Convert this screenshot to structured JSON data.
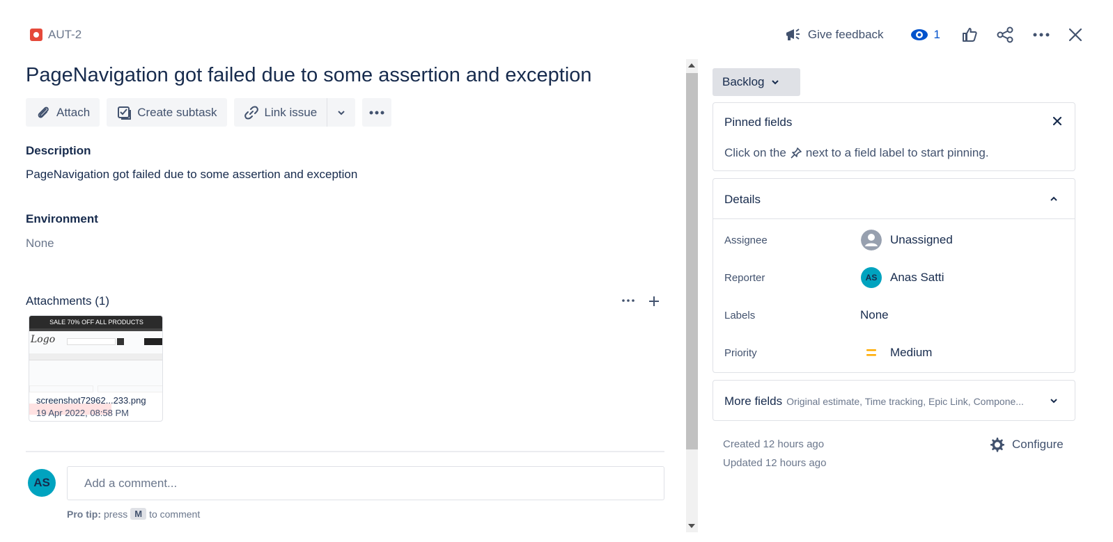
{
  "header": {
    "issue_key": "AUT-2",
    "give_feedback": "Give feedback",
    "watch_count": "1"
  },
  "issue": {
    "title": "PageNavigation got failed due to some assertion and exception",
    "actions": {
      "attach": "Attach",
      "create_subtask": "Create subtask",
      "link_issue": "Link issue"
    },
    "description_label": "Description",
    "description": "PageNavigation got failed due to some assertion and exception",
    "environment_label": "Environment",
    "environment": "None",
    "attachments_label": "Attachments (1)",
    "attachment": {
      "banner": "SALE 70% OFF ALL PRODUCTS",
      "logo": "Logo",
      "name": "screenshot72962...233.png",
      "date": "19 Apr 2022, 08:58 PM"
    }
  },
  "comment": {
    "avatar_initials": "AS",
    "placeholder": "Add a comment...",
    "protip_label": "Pro tip:",
    "protip_press": "press",
    "protip_key": "M",
    "protip_suffix": "to comment"
  },
  "sidebar": {
    "status": "Backlog",
    "pinned": {
      "title": "Pinned fields",
      "hint_before": "Click on the",
      "hint_after": "next to a field label to start pinning."
    },
    "details": {
      "title": "Details",
      "fields": [
        {
          "label": "Assignee",
          "value": "Unassigned"
        },
        {
          "label": "Reporter",
          "value": "Anas Satti",
          "initials": "AS"
        },
        {
          "label": "Labels",
          "value": "None"
        },
        {
          "label": "Priority",
          "value": "Medium"
        }
      ]
    },
    "more_fields": {
      "title": "More fields",
      "summary": "Original estimate, Time tracking, Epic Link, Compone..."
    },
    "created": "Created 12 hours ago",
    "updated": "Updated 12 hours ago",
    "configure": "Configure"
  },
  "colors": {
    "bug": "#e5493a",
    "link": "#0052cc",
    "avatar": "#00a3bf",
    "priority_medium": "#ffab00"
  }
}
